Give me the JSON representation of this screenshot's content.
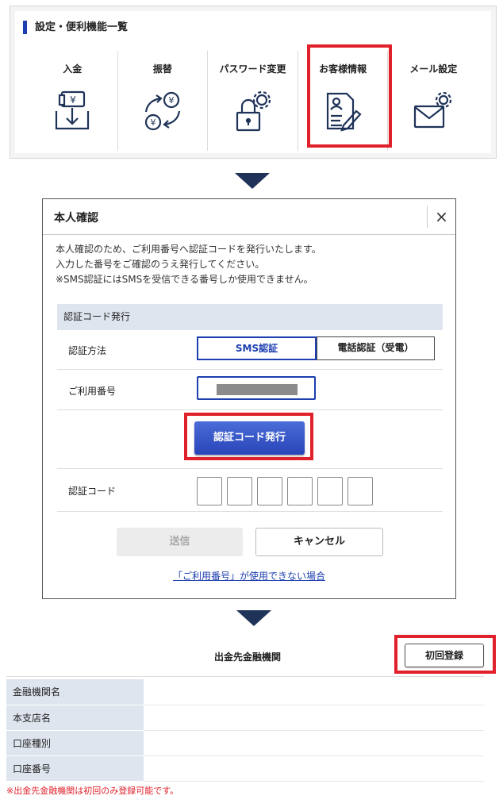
{
  "settings_panel": {
    "title": "設定・便利機能一覧",
    "items": [
      {
        "label": "入金",
        "icon": "deposit-yen-icon"
      },
      {
        "label": "振替",
        "icon": "transfer-yen-icon"
      },
      {
        "label": "パスワード変更",
        "icon": "password-lock-gear-icon"
      },
      {
        "label": "お客様情報",
        "icon": "customer-info-edit-icon"
      },
      {
        "label": "メール設定",
        "icon": "mail-gear-icon"
      }
    ]
  },
  "dialog": {
    "title": "本人確認",
    "close": "×",
    "description": [
      "本人確認のため、ご利用番号へ認証コードを発行いたします。",
      "入力した番号をご確認のうえ発行してください。",
      "※SMS認証にはSMSを受信できる番号しか使用できません。"
    ],
    "section_title": "認証コード発行",
    "auth_method_label": "認証方法",
    "auth_options": [
      "SMS認証",
      "電話認証（受電）"
    ],
    "selected_auth": "SMS認証",
    "number_label": "ご利用番号",
    "issue_button": "認証コード発行",
    "code_label": "認証コード",
    "send_button": "送信",
    "cancel_button": "キャンセル",
    "help_link": "「ご利用番号」が使用できない場合"
  },
  "bank_panel": {
    "title": "出金先金融機関",
    "first_register_button": "初回登録",
    "rows": [
      "金融機関名",
      "本支店名",
      "口座種別",
      "口座番号"
    ],
    "note": "※出金先金融機関は初回のみ登録可能です。"
  },
  "colors": {
    "accent_blue": "#1d3fb0",
    "highlight_red": "#e0202a",
    "arrow_navy": "#1f3358"
  }
}
